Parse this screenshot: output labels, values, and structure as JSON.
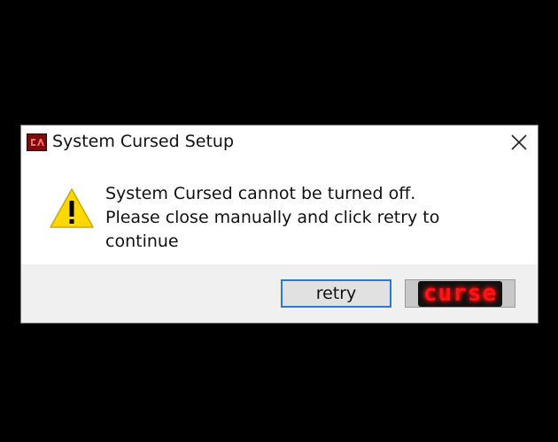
{
  "window": {
    "title": "System Cursed Setup",
    "app_icon": "cursed-app-icon",
    "close_icon": "close-icon"
  },
  "message": {
    "icon": "warning-icon",
    "lines": [
      "System Cursed cannot be turned off.",
      "Please close manually and click retry to",
      "continue"
    ]
  },
  "buttons": {
    "retry_label": "retry",
    "curse_label": "curse"
  },
  "colors": {
    "background": "#000000",
    "dialog": "#ffffff",
    "footer": "#f0f0f0",
    "focus_border": "#2a78d4",
    "warning_yellow": "#ffd800",
    "curse_red": "#ff1414"
  }
}
